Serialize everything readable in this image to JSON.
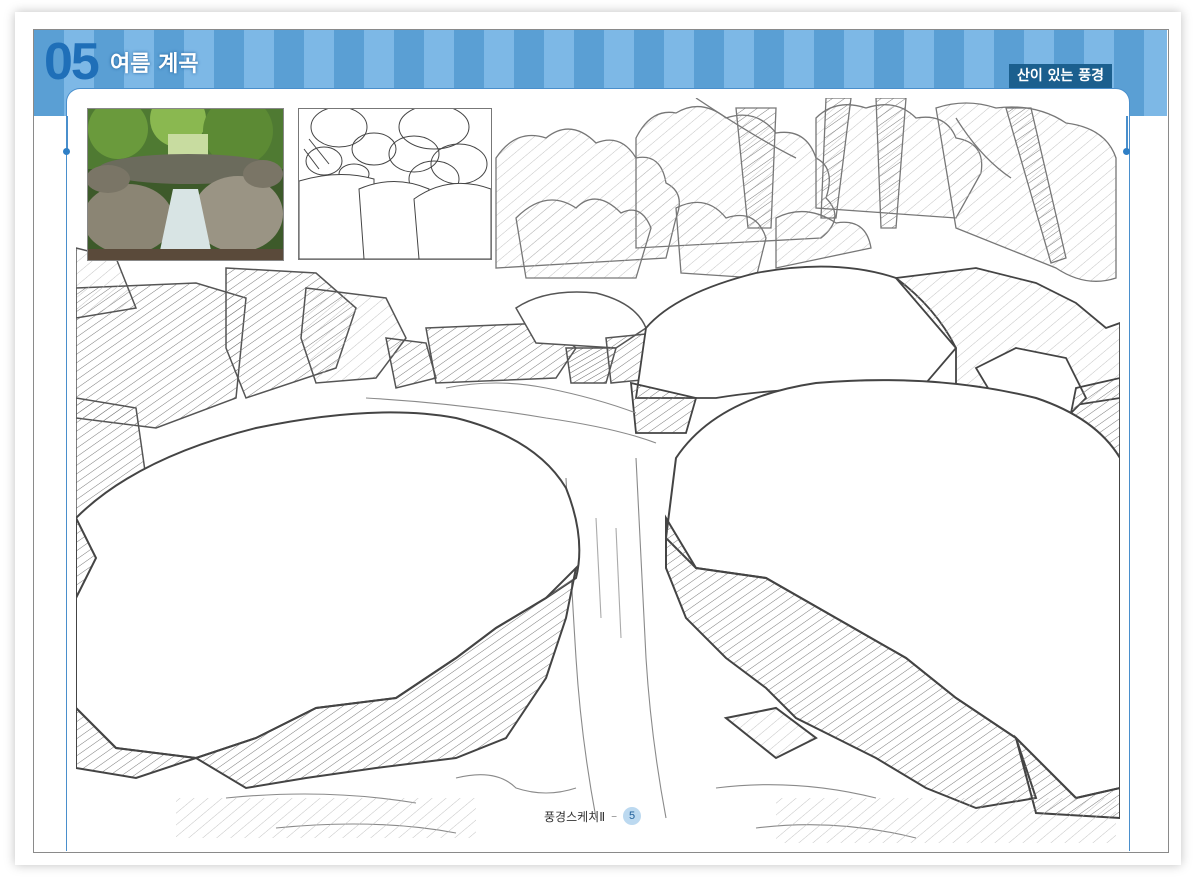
{
  "header": {
    "chapter_number": "05",
    "chapter_title": "여름 계곡",
    "category": "산이 있는 풍경"
  },
  "colors": {
    "header_stripe_dark": "#5a9fd4",
    "header_stripe_light": "#7db8e6",
    "chapter_number": "#1f6fb8",
    "category_tag": "#1b5f8e"
  },
  "footer": {
    "book_title": "풍경스케치Ⅱ",
    "separator": "–",
    "page_number": "5"
  }
}
